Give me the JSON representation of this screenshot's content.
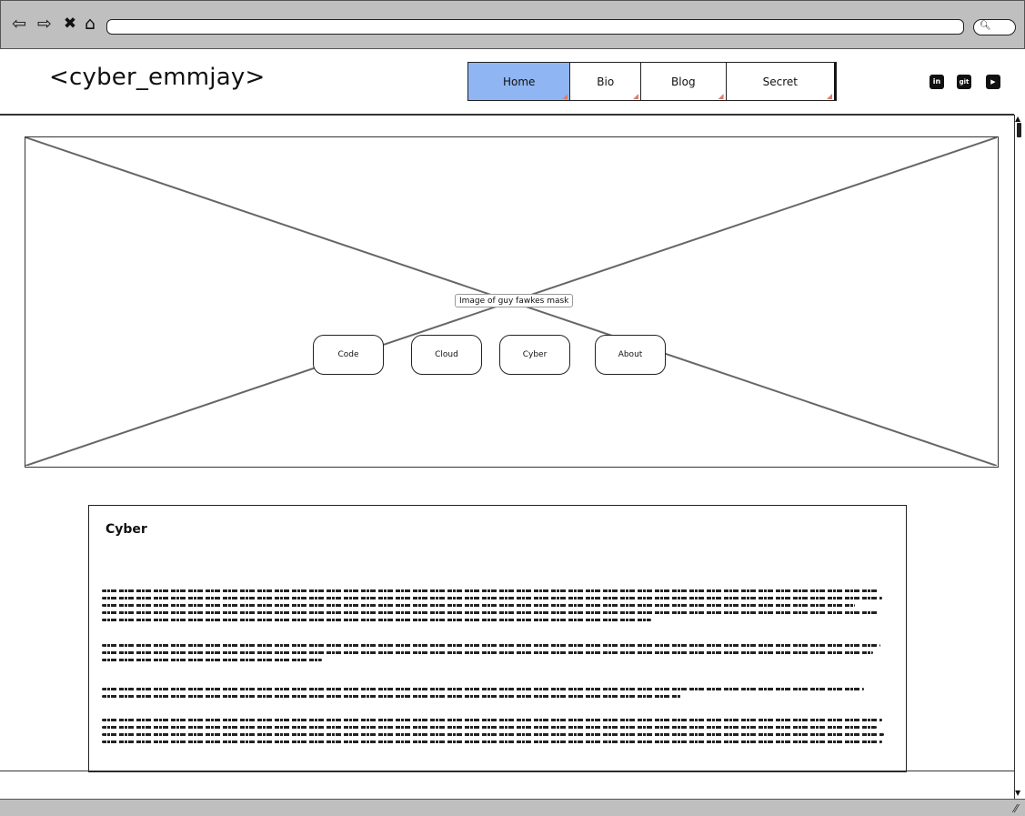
{
  "header": {
    "logo": "<cyber_emmjay>",
    "nav": [
      {
        "label": "Home",
        "active": true
      },
      {
        "label": "Bio",
        "active": false
      },
      {
        "label": "Blog",
        "active": false
      },
      {
        "label": "Secret",
        "active": false
      }
    ],
    "social": [
      {
        "icon": "linkedin-icon",
        "glyph": "in"
      },
      {
        "icon": "git-icon",
        "glyph": "git"
      },
      {
        "icon": "youtube-icon",
        "glyph": "▶"
      }
    ]
  },
  "hero": {
    "image_label": "Image of guy fawkes mask",
    "buttons": [
      "Code",
      "Cloud",
      "Cyber",
      "About"
    ]
  },
  "article": {
    "title": "Cyber"
  },
  "colors": {
    "active_tab": "#8fb5f2",
    "chrome": "#bfbfbf",
    "corner_marker": "#e07b6a"
  }
}
